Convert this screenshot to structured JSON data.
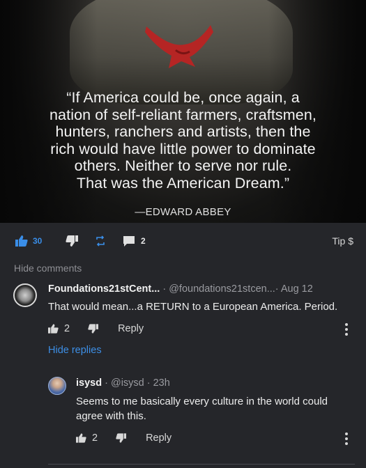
{
  "post_image": {
    "quote": "“If America could be, once again, a\nnation of self-reliant farmers, craftsmen,\nhunters, ranchers and artists, then the\nrich would have little power to dominate\nothers. Neither to serve nor rule.\nThat was the American Dream.”",
    "author": "—EDWARD ABBEY"
  },
  "action_bar": {
    "like_count": "30",
    "comment_count": "2",
    "tip_label": "Tip $",
    "accent_color": "#3a8ee8"
  },
  "comments_section": {
    "hide_comments_label": "Hide comments",
    "hide_replies_label": "Hide replies",
    "comments": [
      {
        "name": "Foundations21stCent...",
        "handle": " · @foundations21stcen...· Aug 12",
        "text": "That would mean...a RETURN to a European America. Period.",
        "likes": "2",
        "reply_label": "Reply"
      },
      {
        "name": "isysd",
        "handle": " · @isysd · 23h",
        "text": "Seems to me basically every culture in the world could agree with this.",
        "likes": "2",
        "reply_label": "Reply"
      }
    ]
  },
  "icons": [
    "thumbs-up-icon",
    "thumbs-down-icon",
    "repost-icon",
    "comment-icon",
    "more-options-icon"
  ]
}
